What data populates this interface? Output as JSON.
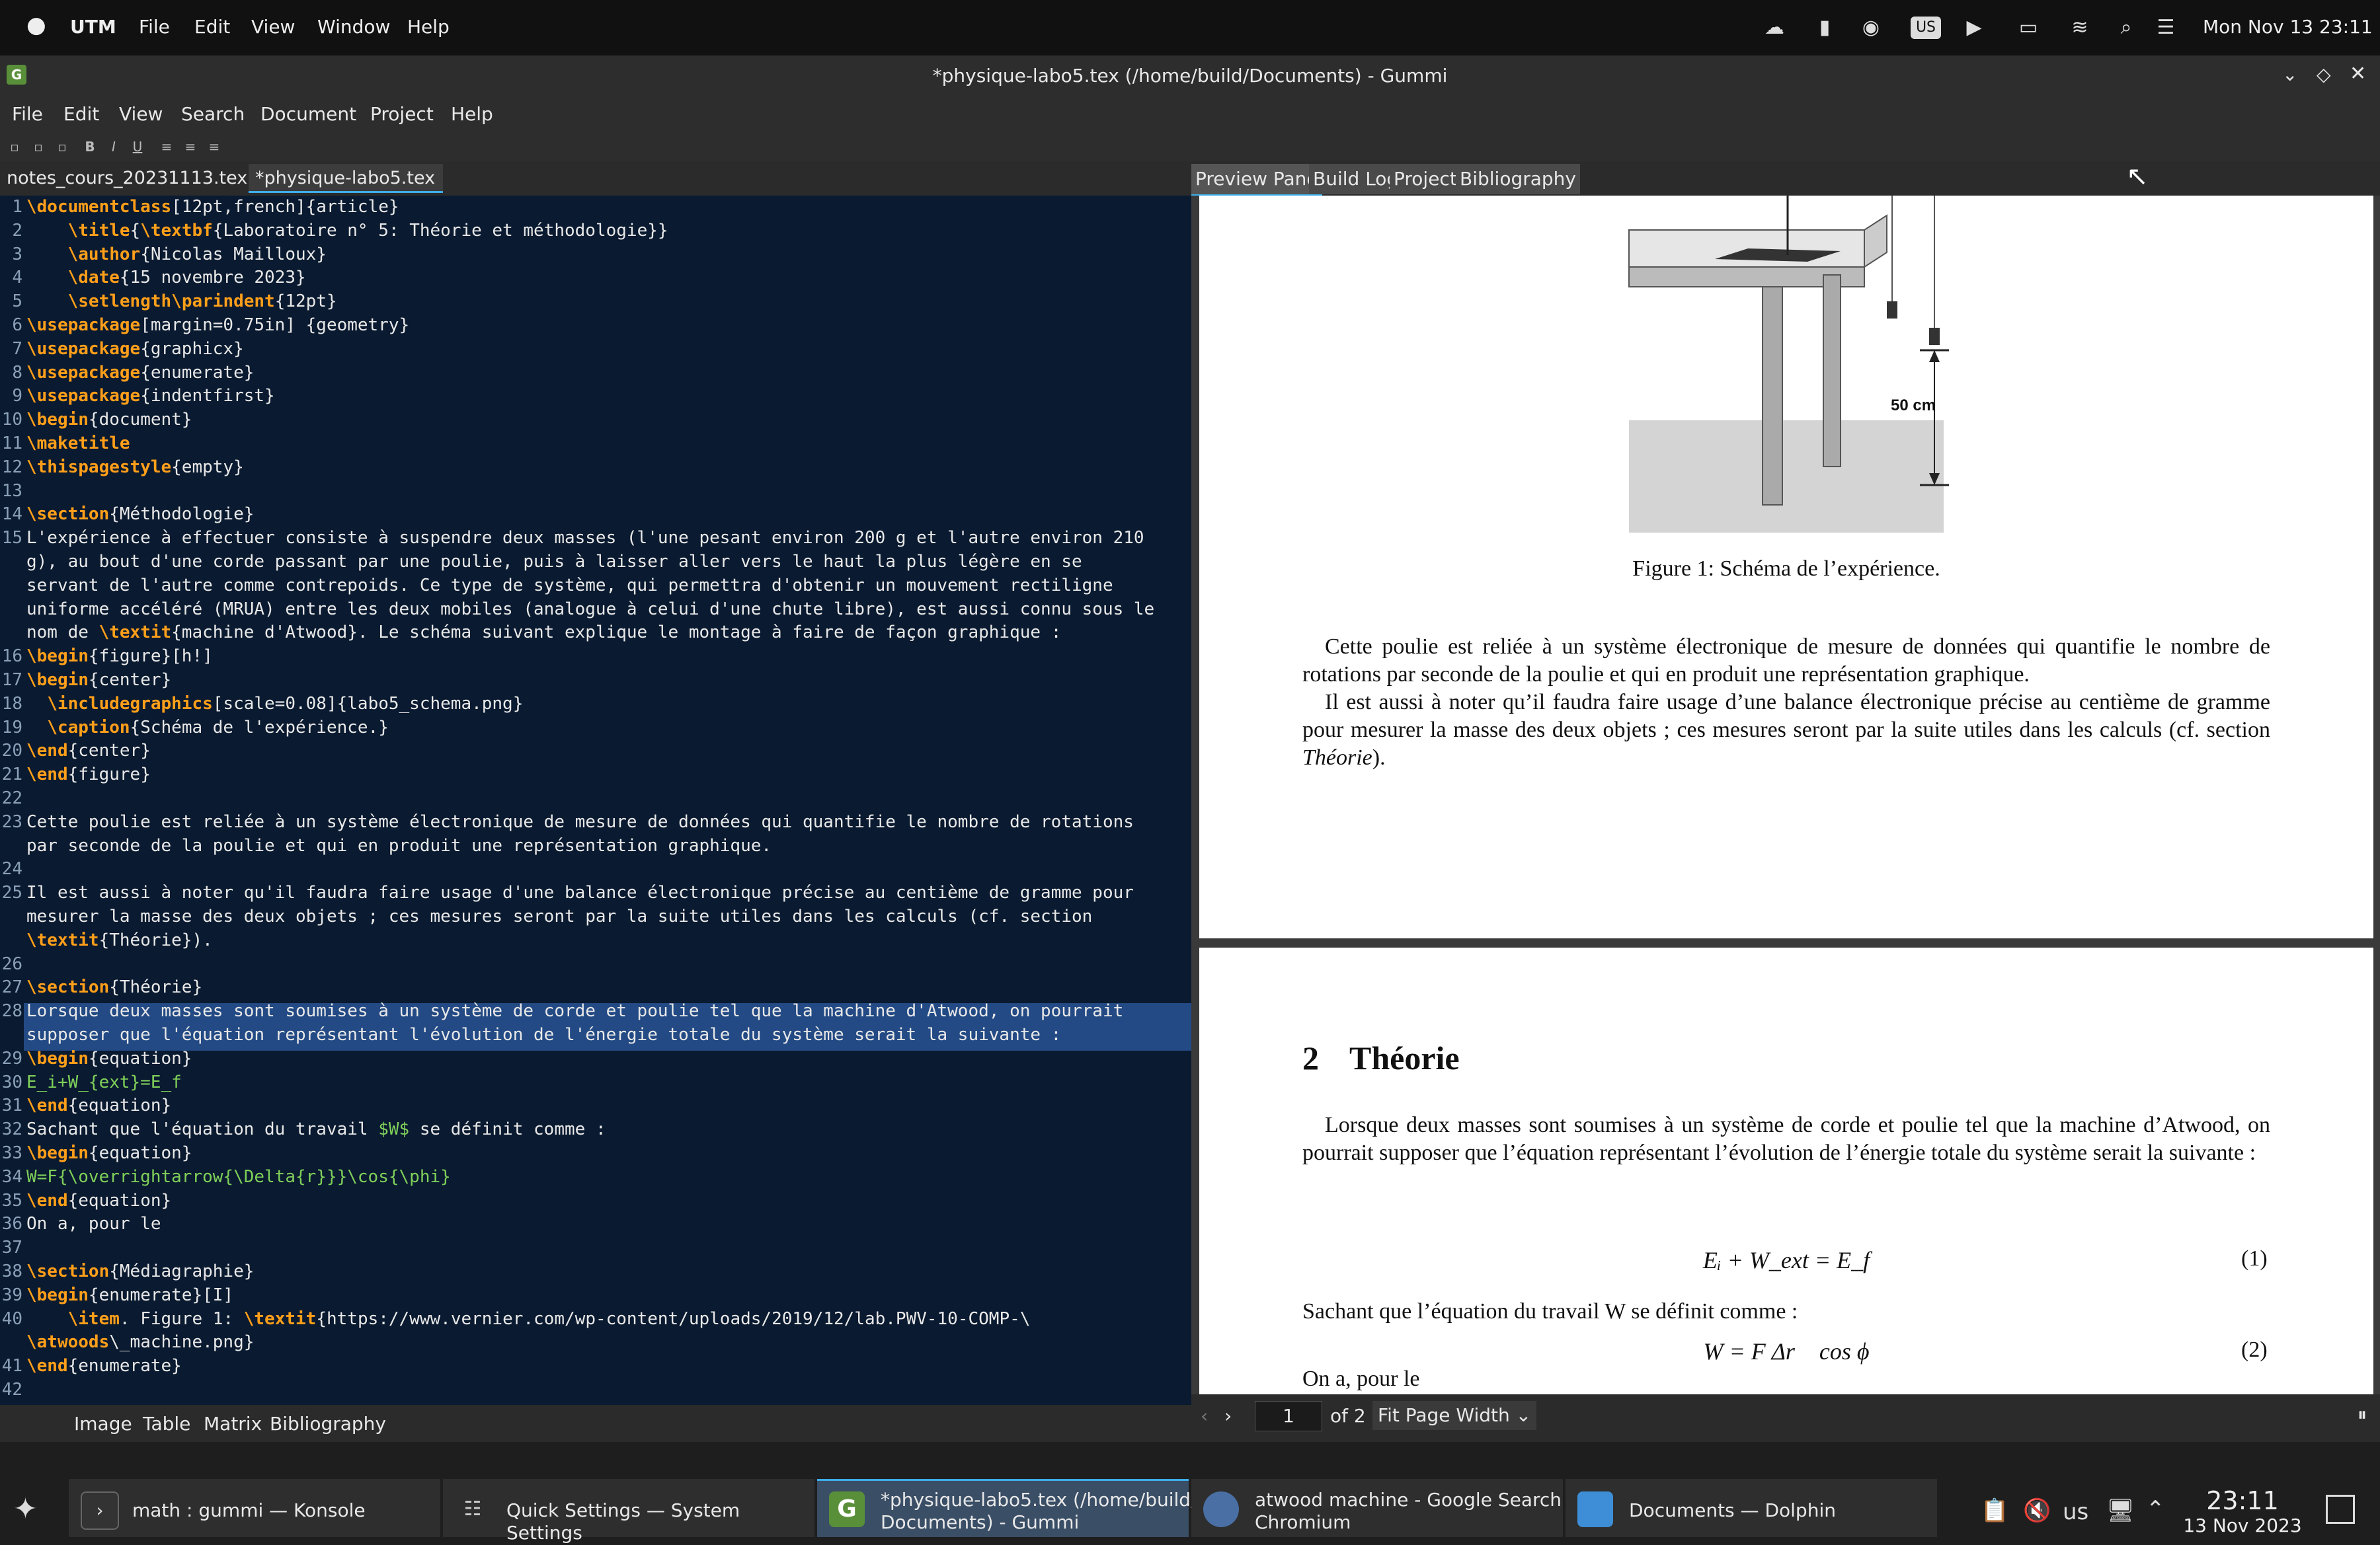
{
  "macbar": {
    "apple": "",
    "app": "UTM",
    "menus": [
      "File",
      "Edit",
      "View",
      "Window",
      "Help"
    ],
    "input_source": "US",
    "datetime": "Mon Nov 13  23:11"
  },
  "window": {
    "title": "*physique-labo5.tex (/home/build/Documents) - Gummi",
    "menus": [
      "File",
      "Edit",
      "View",
      "Search",
      "Document",
      "Project",
      "Help"
    ]
  },
  "editor": {
    "tabs": [
      {
        "label": "notes_cours_20231113.tex",
        "modified": true
      },
      {
        "label": "*physique-labo5.tex",
        "modified": true,
        "active": true
      }
    ],
    "bottom_items": [
      "Image",
      "Table",
      "Matrix",
      "Bibliography"
    ]
  },
  "code_lines": [
    {
      "n": "1",
      "t": "\\documentclass[12pt,french]{article}"
    },
    {
      "n": "2",
      "t": "    \\title{\\textbf{Laboratoire n° 5: Théorie et méthodologie}}"
    },
    {
      "n": "3",
      "t": "    \\author{Nicolas Mailloux}"
    },
    {
      "n": "4",
      "t": "    \\date{15 novembre 2023}"
    },
    {
      "n": "5",
      "t": "    \\setlength\\parindent{12pt}"
    },
    {
      "n": "6",
      "t": "\\usepackage[margin=0.75in] {geometry}"
    },
    {
      "n": "7",
      "t": "\\usepackage{graphicx}"
    },
    {
      "n": "8",
      "t": "\\usepackage{enumerate}"
    },
    {
      "n": "9",
      "t": "\\usepackage{indentfirst}"
    },
    {
      "n": "10",
      "t": "\\begin{document}"
    },
    {
      "n": "11",
      "t": "\\maketitle"
    },
    {
      "n": "12",
      "t": "\\thispagestyle{empty}"
    },
    {
      "n": "13",
      "t": ""
    },
    {
      "n": "14",
      "t": "\\section{Méthodologie}"
    },
    {
      "n": "15",
      "t": "L'expérience à effectuer consiste à suspendre deux masses (l'une pesant environ 200 g et l'autre environ 210"
    },
    {
      "n": "",
      "t": "g), au bout d'une corde passant par une poulie, puis à laisser aller vers le haut la plus légère en se"
    },
    {
      "n": "",
      "t": "servant de l'autre comme contrepoids. Ce type de système, qui permettra d'obtenir un mouvement rectiligne"
    },
    {
      "n": "",
      "t": "uniforme accéléré (MRUA) entre les deux mobiles (analogue à celui d'une chute libre), est aussi connu sous le"
    },
    {
      "n": "",
      "t": "nom de \\textit{machine d'Atwood}. Le schéma suivant explique le montage à faire de façon graphique :"
    },
    {
      "n": "16",
      "t": "\\begin{figure}[h!]"
    },
    {
      "n": "17",
      "t": "\\begin{center}"
    },
    {
      "n": "18",
      "t": "  \\includegraphics[scale=0.08]{labo5_schema.png}"
    },
    {
      "n": "19",
      "t": "  \\caption{Schéma de l'expérience.}"
    },
    {
      "n": "20",
      "t": "\\end{center}"
    },
    {
      "n": "21",
      "t": "\\end{figure}"
    },
    {
      "n": "22",
      "t": ""
    },
    {
      "n": "23",
      "t": "Cette poulie est reliée à un système électronique de mesure de données qui quantifie le nombre de rotations"
    },
    {
      "n": "",
      "t": "par seconde de la poulie et qui en produit une représentation graphique."
    },
    {
      "n": "24",
      "t": ""
    },
    {
      "n": "25",
      "t": "Il est aussi à noter qu'il faudra faire usage d'une balance électronique précise au centième de gramme pour"
    },
    {
      "n": "",
      "t": "mesurer la masse des deux objets ; ces mesures seront par la suite utiles dans les calculs (cf. section"
    },
    {
      "n": "",
      "t": "\\textit{Théorie})."
    },
    {
      "n": "26",
      "t": ""
    },
    {
      "n": "27",
      "t": "\\section{Théorie}"
    },
    {
      "n": "28",
      "t": "Lorsque deux masses sont soumises à un système de corde et poulie tel que la machine d'Atwood, on pourrait"
    },
    {
      "n": "",
      "t": "supposer que l'équation représentant l'évolution de l'énergie totale du système serait la suivante :"
    },
    {
      "n": "29",
      "t": "\\begin{equation}"
    },
    {
      "n": "30",
      "t": "E_i+W_{ext}=E_f"
    },
    {
      "n": "31",
      "t": "\\end{equation}"
    },
    {
      "n": "32",
      "t": "Sachant que l'équation du travail $W$ se définit comme :"
    },
    {
      "n": "33",
      "t": "\\begin{equation}"
    },
    {
      "n": "34",
      "t": "W=F{\\overrightarrow{\\Delta{r}}}\\cos{\\phi}"
    },
    {
      "n": "35",
      "t": "\\end{equation}"
    },
    {
      "n": "36",
      "t": "On a, pour le"
    },
    {
      "n": "37",
      "t": ""
    },
    {
      "n": "38",
      "t": "\\section{Médiagraphie}"
    },
    {
      "n": "39",
      "t": "\\begin{enumerate}[I]"
    },
    {
      "n": "40",
      "t": "    \\item. Figure 1: \\textit{https://www.vernier.com/wp-content/uploads/2019/12/lab.PWV-10-COMP-\\"
    },
    {
      "n": "",
      "t": "\\atwoods\\_machine.png}"
    },
    {
      "n": "41",
      "t": "\\end{enumerate}"
    },
    {
      "n": "42",
      "t": ""
    }
  ],
  "preview": {
    "tabs": [
      "Preview Pane",
      "Build Log",
      "Project",
      "Bibliography"
    ],
    "figure_label": "50 cm",
    "figure_caption": "Figure 1: Schéma de l’expérience.",
    "para1": "Cette poulie est reliée à un système électronique de mesure de données qui quantifie le nombre de rotations par seconde de la poulie et qui en produit une représentation graphique.",
    "para2a": "Il est aussi à noter qu’il faudra faire usage d’une balance électronique précise au centième de gramme pour mesurer la masse des deux objets ; ces mesures seront par la suite utiles dans les calculs (cf. section ",
    "para2b": "Théorie",
    "para2c": ").",
    "section_num": "2",
    "section_title": "Théorie",
    "para3": "Lorsque deux masses sont soumises à un système de corde et poulie tel que la machine d’Atwood, on pourrait supposer que l’équation représentant l’évolution de l’énergie totale du système serait la suivante :",
    "eq1": "Eᵢ + W_ext = E_f",
    "eq1_num": "(1)",
    "para4": "Sachant que l’équation du travail W se définit comme :",
    "eq2": "W = F Δr⃗ cos ϕ",
    "eq2_num": "(2)",
    "para5": "On a, pour le",
    "page_value": "1",
    "page_of": "of 2",
    "zoom": "Fit Page Width"
  },
  "taskbar": {
    "tasks": [
      {
        "label": "math : gummi — Konsole"
      },
      {
        "label": "Quick Settings  — System Settings"
      },
      {
        "label": "*physique-labo5.tex (/home/build/\nDocuments) - Gummi",
        "active": true
      },
      {
        "label": "atwood machine - Google Search -\nChromium"
      },
      {
        "label": "Documents — Dolphin"
      }
    ],
    "kbd": "us",
    "time": "23:11",
    "date": "13 Nov 2023"
  },
  "colors": {
    "editor_bg": "#0a1a30",
    "keyword": "#ff9f1a",
    "math": "#7fd05a",
    "selection": "#234a84",
    "active_task": "#3daee9"
  }
}
